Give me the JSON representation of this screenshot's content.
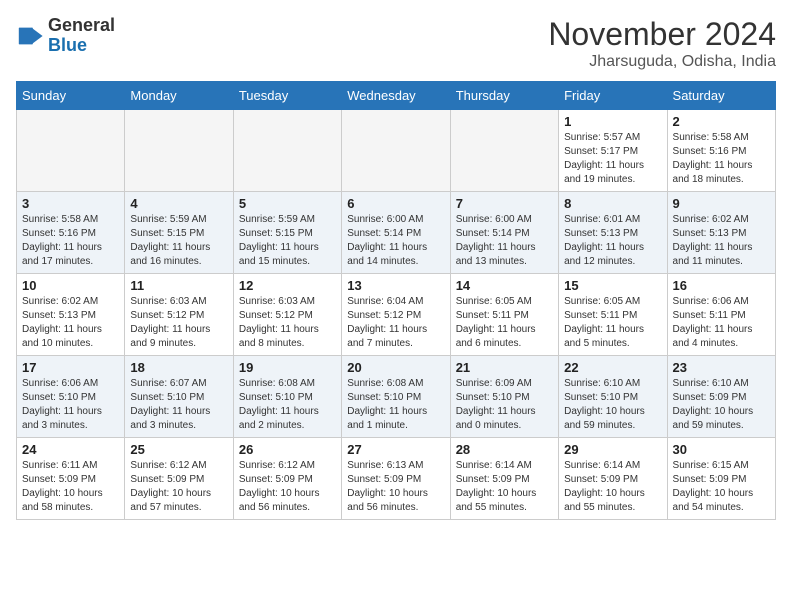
{
  "header": {
    "logo_general": "General",
    "logo_blue": "Blue",
    "month_year": "November 2024",
    "location": "Jharsuguda, Odisha, India"
  },
  "days_of_week": [
    "Sunday",
    "Monday",
    "Tuesday",
    "Wednesday",
    "Thursday",
    "Friday",
    "Saturday"
  ],
  "weeks": [
    [
      {
        "day": "",
        "info": ""
      },
      {
        "day": "",
        "info": ""
      },
      {
        "day": "",
        "info": ""
      },
      {
        "day": "",
        "info": ""
      },
      {
        "day": "",
        "info": ""
      },
      {
        "day": "1",
        "info": "Sunrise: 5:57 AM\nSunset: 5:17 PM\nDaylight: 11 hours and 19 minutes."
      },
      {
        "day": "2",
        "info": "Sunrise: 5:58 AM\nSunset: 5:16 PM\nDaylight: 11 hours and 18 minutes."
      }
    ],
    [
      {
        "day": "3",
        "info": "Sunrise: 5:58 AM\nSunset: 5:16 PM\nDaylight: 11 hours and 17 minutes."
      },
      {
        "day": "4",
        "info": "Sunrise: 5:59 AM\nSunset: 5:15 PM\nDaylight: 11 hours and 16 minutes."
      },
      {
        "day": "5",
        "info": "Sunrise: 5:59 AM\nSunset: 5:15 PM\nDaylight: 11 hours and 15 minutes."
      },
      {
        "day": "6",
        "info": "Sunrise: 6:00 AM\nSunset: 5:14 PM\nDaylight: 11 hours and 14 minutes."
      },
      {
        "day": "7",
        "info": "Sunrise: 6:00 AM\nSunset: 5:14 PM\nDaylight: 11 hours and 13 minutes."
      },
      {
        "day": "8",
        "info": "Sunrise: 6:01 AM\nSunset: 5:13 PM\nDaylight: 11 hours and 12 minutes."
      },
      {
        "day": "9",
        "info": "Sunrise: 6:02 AM\nSunset: 5:13 PM\nDaylight: 11 hours and 11 minutes."
      }
    ],
    [
      {
        "day": "10",
        "info": "Sunrise: 6:02 AM\nSunset: 5:13 PM\nDaylight: 11 hours and 10 minutes."
      },
      {
        "day": "11",
        "info": "Sunrise: 6:03 AM\nSunset: 5:12 PM\nDaylight: 11 hours and 9 minutes."
      },
      {
        "day": "12",
        "info": "Sunrise: 6:03 AM\nSunset: 5:12 PM\nDaylight: 11 hours and 8 minutes."
      },
      {
        "day": "13",
        "info": "Sunrise: 6:04 AM\nSunset: 5:12 PM\nDaylight: 11 hours and 7 minutes."
      },
      {
        "day": "14",
        "info": "Sunrise: 6:05 AM\nSunset: 5:11 PM\nDaylight: 11 hours and 6 minutes."
      },
      {
        "day": "15",
        "info": "Sunrise: 6:05 AM\nSunset: 5:11 PM\nDaylight: 11 hours and 5 minutes."
      },
      {
        "day": "16",
        "info": "Sunrise: 6:06 AM\nSunset: 5:11 PM\nDaylight: 11 hours and 4 minutes."
      }
    ],
    [
      {
        "day": "17",
        "info": "Sunrise: 6:06 AM\nSunset: 5:10 PM\nDaylight: 11 hours and 3 minutes."
      },
      {
        "day": "18",
        "info": "Sunrise: 6:07 AM\nSunset: 5:10 PM\nDaylight: 11 hours and 3 minutes."
      },
      {
        "day": "19",
        "info": "Sunrise: 6:08 AM\nSunset: 5:10 PM\nDaylight: 11 hours and 2 minutes."
      },
      {
        "day": "20",
        "info": "Sunrise: 6:08 AM\nSunset: 5:10 PM\nDaylight: 11 hours and 1 minute."
      },
      {
        "day": "21",
        "info": "Sunrise: 6:09 AM\nSunset: 5:10 PM\nDaylight: 11 hours and 0 minutes."
      },
      {
        "day": "22",
        "info": "Sunrise: 6:10 AM\nSunset: 5:10 PM\nDaylight: 10 hours and 59 minutes."
      },
      {
        "day": "23",
        "info": "Sunrise: 6:10 AM\nSunset: 5:09 PM\nDaylight: 10 hours and 59 minutes."
      }
    ],
    [
      {
        "day": "24",
        "info": "Sunrise: 6:11 AM\nSunset: 5:09 PM\nDaylight: 10 hours and 58 minutes."
      },
      {
        "day": "25",
        "info": "Sunrise: 6:12 AM\nSunset: 5:09 PM\nDaylight: 10 hours and 57 minutes."
      },
      {
        "day": "26",
        "info": "Sunrise: 6:12 AM\nSunset: 5:09 PM\nDaylight: 10 hours and 56 minutes."
      },
      {
        "day": "27",
        "info": "Sunrise: 6:13 AM\nSunset: 5:09 PM\nDaylight: 10 hours and 56 minutes."
      },
      {
        "day": "28",
        "info": "Sunrise: 6:14 AM\nSunset: 5:09 PM\nDaylight: 10 hours and 55 minutes."
      },
      {
        "day": "29",
        "info": "Sunrise: 6:14 AM\nSunset: 5:09 PM\nDaylight: 10 hours and 55 minutes."
      },
      {
        "day": "30",
        "info": "Sunrise: 6:15 AM\nSunset: 5:09 PM\nDaylight: 10 hours and 54 minutes."
      }
    ]
  ]
}
